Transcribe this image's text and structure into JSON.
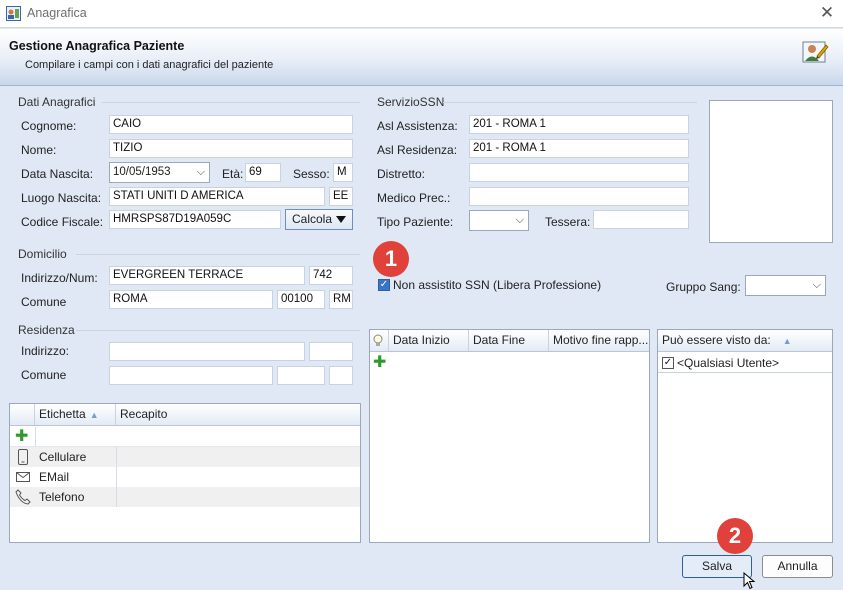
{
  "window": {
    "title": "Anagrafica",
    "close_glyph": "✕"
  },
  "header": {
    "title": "Gestione Anagrafica Paziente",
    "subtitle": "Compilare i campi con i dati anagrafici del paziente"
  },
  "dati_anagrafici": {
    "group_label": "Dati Anagrafici",
    "cognome_label": "Cognome:",
    "cognome": "CAIO",
    "nome_label": "Nome:",
    "nome": "TIZIO",
    "data_nascita_label": "Data Nascita:",
    "data_nascita": "10/05/1953",
    "eta_label": "Età:",
    "eta": "69",
    "sesso_label": "Sesso:",
    "sesso": "M",
    "luogo_nascita_label": "Luogo Nascita:",
    "luogo_nascita": "STATI UNITI D AMERICA",
    "luogo_prov": "EE",
    "codice_fiscale_label": "Codice Fiscale:",
    "codice_fiscale": "HMRSPS87D19A059C",
    "calcola_label": "Calcola"
  },
  "domicilio": {
    "group_label": "Domicilio",
    "indirizzo_label": "Indirizzo/Num:",
    "indirizzo": "EVERGREEN TERRACE",
    "numero": "742",
    "comune_label": "Comune",
    "comune": "ROMA",
    "cap": "00100",
    "prov": "RM"
  },
  "residenza": {
    "group_label": "Residenza",
    "indirizzo_label": "Indirizzo:",
    "indirizzo": "",
    "numero": "",
    "comune_label": "Comune",
    "comune": "",
    "cap": "",
    "prov": ""
  },
  "servizio_ssn": {
    "group_label": "ServizioSSN",
    "asl_assistenza_label": "Asl Assistenza:",
    "asl_assistenza": "201 - ROMA 1",
    "asl_residenza_label": "Asl Residenza:",
    "asl_residenza": "201 - ROMA 1",
    "distretto_label": "Distretto:",
    "distretto": "",
    "medico_label": "Medico Prec.:",
    "medico": "",
    "tipo_paziente_label": "Tipo Paziente:",
    "tipo_paziente": "",
    "tessera_label": "Tessera:",
    "tessera": ""
  },
  "non_assistito": {
    "label": "Non assistito SSN (Libera Professione)",
    "checked": true
  },
  "gruppo_sang": {
    "label": "Gruppo Sang:",
    "value": ""
  },
  "contatti_grid": {
    "headers": [
      "Etichetta",
      "Recapito"
    ],
    "rows": [
      {
        "icon": "phone-mobile-icon",
        "etichetta": "Cellulare",
        "recapito": ""
      },
      {
        "icon": "email-icon",
        "etichetta": "EMail",
        "recapito": ""
      },
      {
        "icon": "telephone-icon",
        "etichetta": "Telefono",
        "recapito": ""
      }
    ]
  },
  "periodi_grid": {
    "headers": [
      "Data Inizio",
      "Data Fine",
      "Motivo fine rapp..."
    ]
  },
  "visibilita_grid": {
    "header": "Può essere visto da:",
    "rows": [
      {
        "label": "<Qualsiasi Utente>",
        "checked": true
      }
    ]
  },
  "badges": {
    "one": "1",
    "two": "2"
  },
  "buttons": {
    "salva": "Salva",
    "annulla": "Annulla"
  }
}
